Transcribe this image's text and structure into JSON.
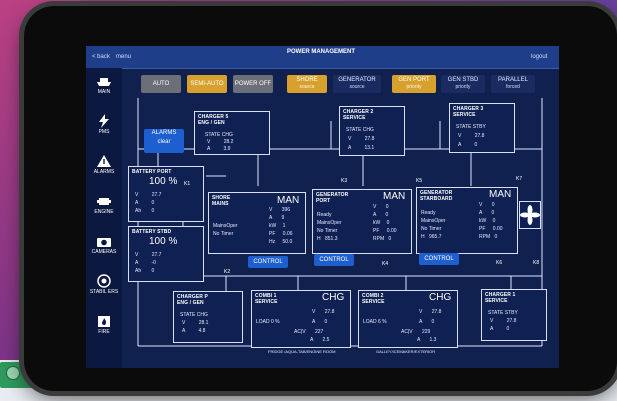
{
  "screen": {
    "title": "POWER MANAGEMENT",
    "top_left": {
      "back": "< back",
      "menu": "menu"
    },
    "top_right": "logout"
  },
  "modes": [
    {
      "label": "AUTO",
      "style": "gray"
    },
    {
      "label": "SEMI-AUTO",
      "style": "yellow"
    },
    {
      "label": "POWER OFF",
      "style": "gray"
    },
    {
      "label": "SHORE",
      "sub": "source",
      "style": "yellow"
    },
    {
      "label": "GENERATOR",
      "sub": "source",
      "style": "dark"
    },
    {
      "label": "GEN PORT",
      "sub": "priority",
      "style": "yellow"
    },
    {
      "label": "GEN STBD",
      "sub": "priority",
      "style": "dark"
    },
    {
      "label": "PARALLEL",
      "sub": "forced",
      "style": "dark"
    }
  ],
  "sidebar": [
    {
      "label": "MAIN",
      "icon": "boat-icon"
    },
    {
      "label": "PMS",
      "icon": "lightning-icon"
    },
    {
      "label": "ALARMS",
      "icon": "warning-icon"
    },
    {
      "label": "ENGINE",
      "icon": "engine-icon"
    },
    {
      "label": "CAMERAS",
      "icon": "camera-icon"
    },
    {
      "label": "STABIL ERS",
      "icon": "stabilizer-icon"
    },
    {
      "label": "FIRE",
      "icon": "fire-icon"
    }
  ],
  "alarms_button": {
    "label": "ALARMS",
    "sub": "clear"
  },
  "chargers_top": [
    {
      "title": "CHARGER 5",
      "subtitle": "ENG / GEN",
      "state": "CHG",
      "v": "28.2",
      "a": "3.9"
    },
    {
      "title": "CHARGER 2",
      "subtitle": "SERVICE",
      "state": "CHG",
      "v": "27.8",
      "a": "13.1"
    },
    {
      "title": "CHARGER 3",
      "subtitle": "SERVICE",
      "state": "STBY",
      "v": "27.8",
      "a": "0"
    }
  ],
  "battery_port": {
    "title": "BATTERY PORT",
    "pct": "100 %",
    "v": "27.7",
    "a": "0",
    "ah": "0"
  },
  "battery_stbd": {
    "title": "BATTERY STBD",
    "pct": "100 %",
    "v": "27.7",
    "a": "-0",
    "ah": "0"
  },
  "shore": {
    "title": "SHORE",
    "subtitle": "MAINS",
    "mode": "MAN",
    "v": "396",
    "a": "9",
    "kw": "1",
    "pf": "0.06",
    "hz": "50.0",
    "label1": "MainsOper",
    "label2": "No Timer"
  },
  "gen_port": {
    "title": "GENERATOR",
    "subtitle": "PORT",
    "mode": "MAN",
    "state": "Ready",
    "state2": "MainsOper",
    "state3": "No Timer",
    "h": "851.3",
    "v": "0",
    "a": "0",
    "kw": "0",
    "pf": "0.00",
    "rpm": "0"
  },
  "gen_stbd": {
    "title": "GENERATOR",
    "subtitle": "STARBOARD",
    "mode": "MAN",
    "state": "Ready",
    "state2": "MainsOper",
    "state3": "No Timer",
    "h": "965.7",
    "v": "0",
    "a": "0",
    "kw": "0",
    "pf": "0.00",
    "rpm": "0"
  },
  "control_label": "CONTROL",
  "k_labels": [
    "K1",
    "K2",
    "K3",
    "K4",
    "K5",
    "K6",
    "K7",
    "K8"
  ],
  "chargers_bottom": [
    {
      "title": "CHARGER P",
      "subtitle": "ENG / GEN",
      "state": "CHG",
      "v": "28.1",
      "a": "4.8"
    },
    {
      "title": "COMBI 1",
      "subtitle": "SERVICE",
      "mode": "CHG",
      "load": "LOAD 0 %",
      "v": "27.8",
      "a": "0",
      "acv": "227",
      "aca": "2.5"
    },
    {
      "title": "COMBI 2",
      "subtitle": "SERVICE",
      "mode": "CHG",
      "load": "LOAD 6 %",
      "v": "27.8",
      "a": "0",
      "acv": "229",
      "aca": "1.3"
    },
    {
      "title": "CHARGER 1",
      "subtitle": "SERVICE",
      "state": "STBY",
      "v": "27.8",
      "a": "0"
    }
  ],
  "bottom_captions": [
    "FRIDGE /AQUA-TAB/ENGINE ROOM",
    "GALLEY/ICEMAKER/EXTERIOR"
  ]
}
